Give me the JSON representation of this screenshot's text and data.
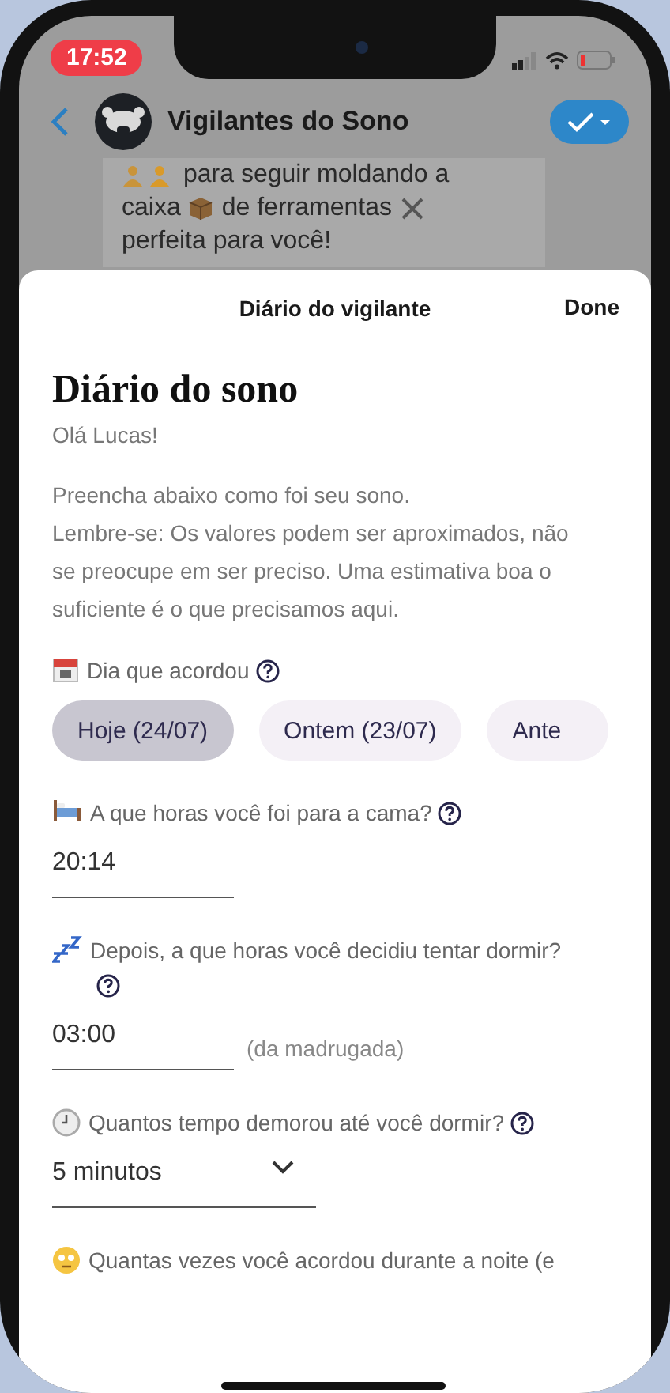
{
  "status_bar": {
    "time": "17:52"
  },
  "chat_header": {
    "title": "Vigilantes do Sono"
  },
  "background_message": {
    "lines": [
      {
        "text": "para seguir moldando a"
      },
      {
        "before": "caixa",
        "after": "de ferramentas"
      },
      {
        "text": "perfeita para você!"
      }
    ]
  },
  "sheet": {
    "title": "Diário do vigilante",
    "done": "Done"
  },
  "form": {
    "heading": "Diário do sono",
    "greeting": "Olá Lucas!",
    "intro": [
      "Preencha abaixo como foi seu sono.",
      "Lembre-se: Os valores podem ser aproximados, não se preocupe em ser preciso. Uma estimativa boa o suficiente é o que precisamos aqui."
    ],
    "questions": [
      {
        "kind": "chips",
        "label": "Dia que acordou",
        "help": true,
        "options": [
          {
            "label": "Hoje (24/07)",
            "selected": true
          },
          {
            "label": "Ontem (23/07)",
            "selected": false
          },
          {
            "label": "Ante",
            "selected": false
          }
        ]
      },
      {
        "kind": "time",
        "label": "A que horas você foi para a cama?",
        "help": true,
        "value": "20:14"
      },
      {
        "kind": "time",
        "label": "Depois, a que horas você decidiu tentar dormir?",
        "help": true,
        "value": "03:00",
        "note": "(da madrugada)"
      },
      {
        "kind": "select",
        "label": "Quantos tempo demorou até você dormir?",
        "help": true,
        "value": "5 minutos"
      },
      {
        "kind": "text",
        "label": "Quantas vezes você acordou durante a noite (e",
        "help": false
      }
    ]
  }
}
